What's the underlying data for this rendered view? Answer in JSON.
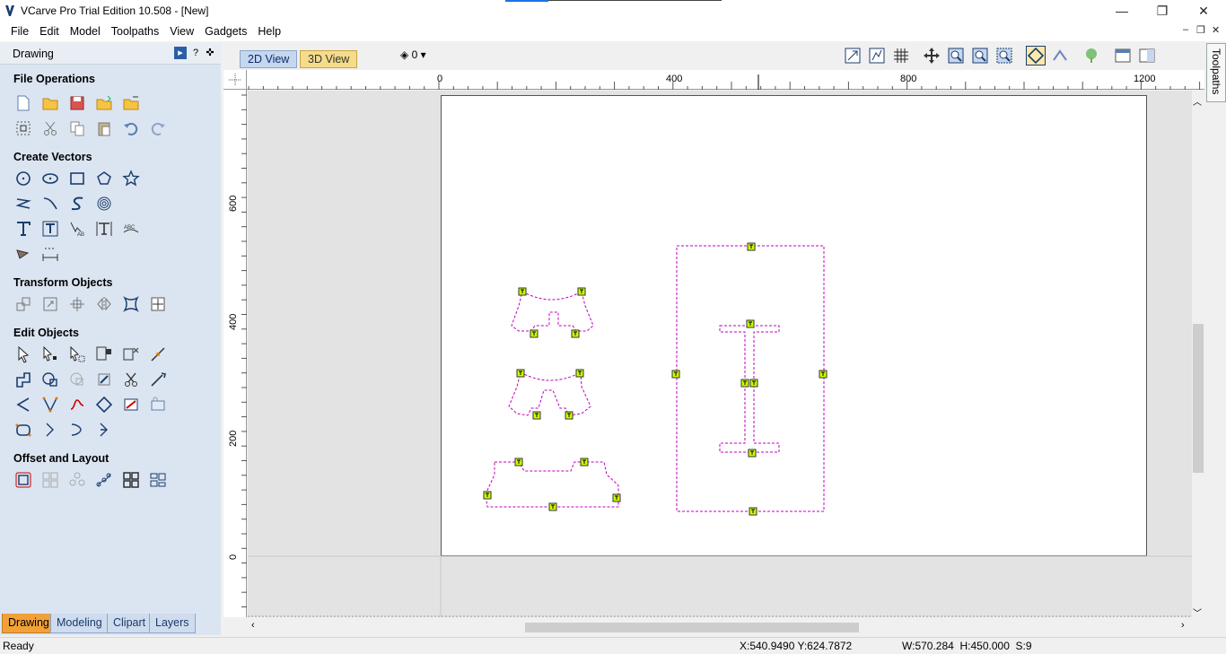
{
  "window": {
    "title": "VCarve Pro Trial Edition 10.508 - [New]",
    "minimize_glyph": "—",
    "maximize_glyph": "❐",
    "close_glyph": "✕"
  },
  "menu": [
    "File",
    "Edit",
    "Model",
    "Toolpaths",
    "View",
    "Gadgets",
    "Help"
  ],
  "mdi_controls": {
    "minimize": "–",
    "restore": "❐",
    "close": "✕"
  },
  "panel": {
    "title": "Drawing",
    "help_glyph": "?",
    "pin_glyph": "✜",
    "sections": {
      "file_operations": "File Operations",
      "create_vectors": "Create Vectors",
      "transform_objects": "Transform Objects",
      "edit_objects": "Edit Objects",
      "offset_layout": "Offset and Layout"
    },
    "icons": {
      "file_operations": [
        "new-file-icon",
        "open-file-icon",
        "save-file-icon",
        "import-vectors-icon",
        "import-bitmap-icon",
        "select-all-icon",
        "cut-icon",
        "copy-icon",
        "paste-icon",
        "undo-icon",
        "redo-icon"
      ],
      "create_vectors": [
        "circle-icon",
        "ellipse-icon",
        "rectangle-icon",
        "polygon-icon",
        "star-icon",
        "polyline-icon",
        "arc-icon",
        "curve-icon",
        "fingerprint-icon",
        "text-icon",
        "autoscale-text-icon",
        "text-on-curve-icon",
        "auto-layout-text-icon",
        "text-arc-icon",
        "trace-bitmap-icon",
        "dimension-icon"
      ],
      "transform_objects": [
        "move-icon",
        "set-size-icon",
        "align-icon",
        "mirror-icon",
        "distort-icon",
        "center-icon"
      ],
      "edit_objects": [
        "select-icon",
        "node-edit-icon",
        "interactive-select-icon",
        "group-icon",
        "ungroup-icon",
        "join-icon",
        "weld-icon",
        "subtract-icon",
        "intersect-icon",
        "fillet-icon",
        "trim-icon",
        "extend-icon",
        "smooth-icon",
        "fillet-corner-icon",
        "curve-fit-icon",
        "close-vector-icon",
        "bitmap-edit-icon",
        "layer-icon",
        "scale-icon",
        "spline-icon",
        "arrow-icon",
        "chevron-icon"
      ],
      "offset_layout": [
        "offset-icon",
        "array-copy-icon",
        "rotate-copy-icon",
        "copy-along-vectors-icon",
        "nest-icon",
        "nesting-parts-icon"
      ]
    },
    "tabs": [
      {
        "label": "Drawing",
        "active": true
      },
      {
        "label": "Modeling",
        "active": false
      },
      {
        "label": "Clipart",
        "active": false
      },
      {
        "label": "Layers",
        "active": false
      }
    ]
  },
  "view": {
    "tabs": [
      {
        "label": "2D View",
        "active": true
      },
      {
        "label": "3D View",
        "active": false
      }
    ],
    "layer_value": "0",
    "toolbar_icons": [
      "zoom-extents-icon",
      "snap-icon",
      "grid-icon",
      "pan-icon",
      "zoom-in-icon",
      "zoom-out-icon",
      "zoom-box-icon",
      "show-vectors-icon",
      "show-toolpaths-icon",
      "tree-icon",
      "layout-left-icon",
      "layout-right-icon"
    ]
  },
  "ruler": {
    "h_labels": [
      "0",
      "400",
      "800",
      "1200"
    ],
    "v_labels": [
      "600",
      "400",
      "200",
      "0"
    ]
  },
  "side_tab": "Toolpaths",
  "status": {
    "left": "Ready",
    "coords": "X:540.9490 Y:624.7872",
    "dims": "W:570.284  H:450.000  S:9"
  },
  "colors": {
    "panel_bg": "#dbe5f1",
    "vector": "#c000c0",
    "node_fill": "#ccff00",
    "active_tab": "#f2a13a"
  }
}
